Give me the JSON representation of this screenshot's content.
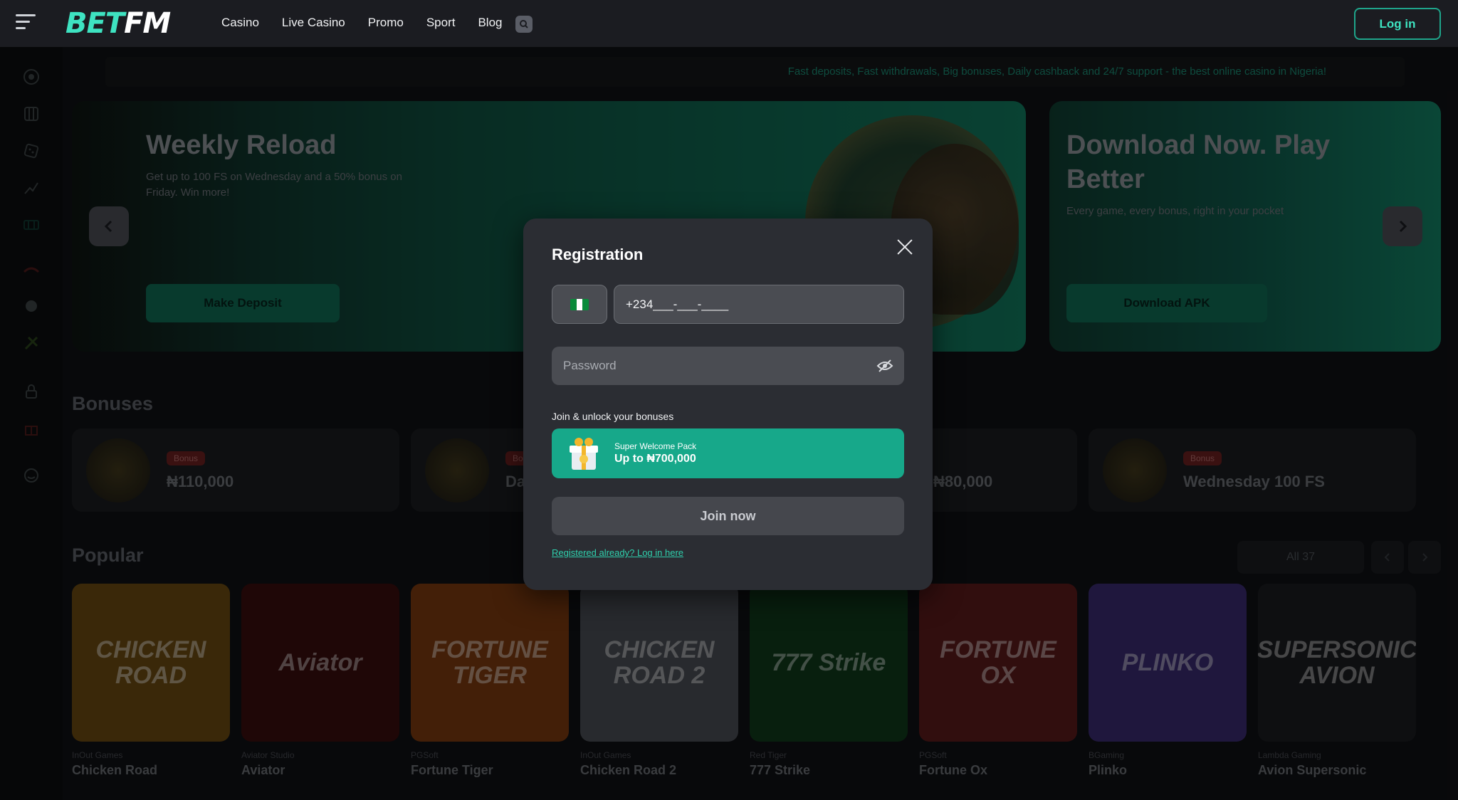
{
  "header": {
    "logo_bet": "BET",
    "logo_fm": "FM",
    "nav": [
      "Casino",
      "Live Casino",
      "Promo",
      "Sport",
      "Blog"
    ],
    "login_label": "Log in"
  },
  "ticker": "Fast deposits, Fast withdrawals, Big bonuses, Daily cashback and 24/7 support - the best online casino in Nigeria!",
  "banners": [
    {
      "title": "Weekly Reload",
      "text": "Get up to 100 FS on Wednesday and a 50% bonus on Friday. Win more!",
      "cta": "Make Deposit"
    },
    {
      "title": "Download Now. Play Better",
      "text": "Every game, every bonus, right in your pocket",
      "cta": "Download APK"
    }
  ],
  "bonuses": {
    "title": "Bonuses",
    "items": [
      {
        "badge": "Bonus",
        "value": "₦110,000"
      },
      {
        "badge": "Bonus",
        "value": "Da"
      },
      {
        "badge": "",
        "value": "₦80,000"
      },
      {
        "badge": "Bonus",
        "value": "Wednesday 100 FS"
      }
    ]
  },
  "popular": {
    "title": "Popular",
    "all_label": "All 37",
    "games": [
      {
        "name": "Chicken Road",
        "provider": "InOut Games",
        "art": "CHICKEN ROAD",
        "color": "#6a4a12"
      },
      {
        "name": "Aviator",
        "provider": "Aviator Studio",
        "art": "Aviator",
        "color": "#3a0d0d"
      },
      {
        "name": "Fortune Tiger",
        "provider": "PGSoft",
        "art": "FORTUNE TIGER",
        "color": "#7a3a10"
      },
      {
        "name": "Chicken Road 2",
        "provider": "InOut Games",
        "art": "CHICKEN ROAD 2",
        "color": "#4a4e55"
      },
      {
        "name": "777 Strike",
        "provider": "Red Tiger",
        "art": "777 Strike",
        "color": "#103a1a"
      },
      {
        "name": "Fortune Ox",
        "provider": "PGSoft",
        "art": "FORTUNE OX",
        "color": "#5a1a1a"
      },
      {
        "name": "Plinko",
        "provider": "BGaming",
        "art": "PLINKO",
        "color": "#3a2a70"
      },
      {
        "name": "Avion Supersonic",
        "provider": "Lambda Gaming",
        "art": "SUPERSONIC AVION",
        "color": "#1a1c20"
      }
    ]
  },
  "modal": {
    "title": "Registration",
    "phone_value": "+234___-___-____",
    "password_placeholder": "Password",
    "unlock_label": "Join & unlock your bonuses",
    "pack_title": "Super Welcome Pack",
    "pack_value": "Up to ₦700,000",
    "join_label": "Join now",
    "login_link": "Registered already? Log in here"
  },
  "colors": {
    "accent": "#3ee3c1",
    "bonus_pack": "#17a88a",
    "modal_bg": "#2b2d33"
  },
  "icons": {
    "sidebar": [
      "casino-chip-icon",
      "slots-icon",
      "dice-icon",
      "crash-icon",
      "live-table-icon",
      "hat-icon",
      "poker-icon",
      "sport-icon",
      "lock-icon",
      "gift-icon",
      "support-icon"
    ]
  }
}
